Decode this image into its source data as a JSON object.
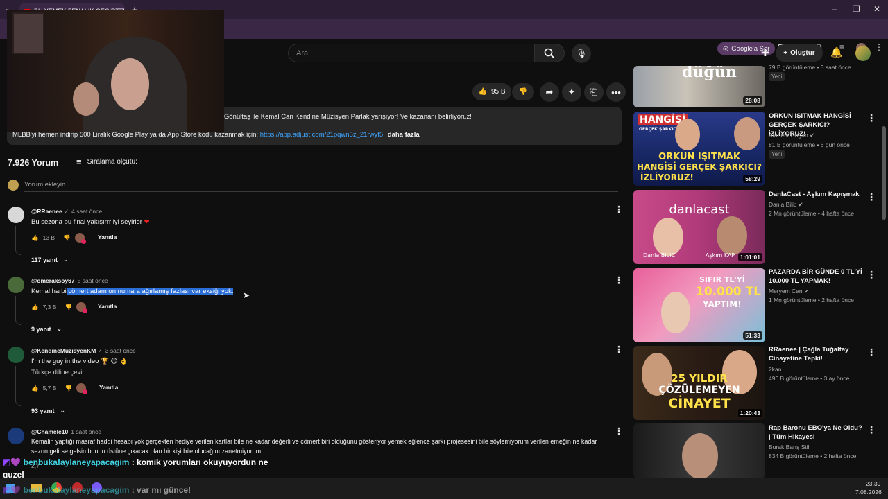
{
  "browser": {
    "tab_title": "BU YEMEK FENALIK GEÇİRTTİ!",
    "google_sor": "Google'a Sor"
  },
  "header": {
    "search_placeholder": "Ara",
    "create_label": "Oluştur"
  },
  "video": {
    "likes": "95 B"
  },
  "description": {
    "line1": "n Gönültaş ile Kemal Can Kendine Müzisyen Parlak yarışıyor! Ve kazananı belirliyoruz!",
    "line2": "MLBB'yi hemen indirip 500 Liralık Google Play ya da App Store kodu kazanmak için:",
    "link": "https://app.adjust.com/21pqwn5z_21rwyf5",
    "more": "daha fazla"
  },
  "comments_section": {
    "count": "7.926 Yorum",
    "sort_label": "Sıralama ölçütü:",
    "add_placeholder": "Yorum ekleyin..."
  },
  "comments": [
    {
      "user": "@RRaenee",
      "time": "4 saat önce",
      "text": "Bu sezona bu final yakışırrr iyi seyirler",
      "likes": "13 B",
      "reply": "Yanıtla",
      "replies": "117 yanıt",
      "avatar_color": "#d8d8d8"
    },
    {
      "user": "@omeraksoy67",
      "time": "5 saat önce",
      "text_pre": "Kemal harbi",
      "text_sel": " cömert adam on numara ağırlamış fazlası var eksiği yok.",
      "likes": "7,3 B",
      "reply": "Yanıtla",
      "replies": "9 yanıt",
      "avatar_color": "#4a6a3a"
    },
    {
      "user": "@KendineMüzisyenKM",
      "time": "3 saat önce",
      "text": "I'm the guy in the video 🏆 😌 👌",
      "translate": "Türkçe diline çevir",
      "likes": "5,7 B",
      "reply": "Yanıtla",
      "replies": "93 yanıt",
      "avatar_color": "#1f5a3a"
    },
    {
      "user": "@Chamele10",
      "time": "1 saat önce",
      "text_l1": "Kemalin yaptığı masraf haddi hesabı yok gerçekten hediye verilen kartlar bile ne kadar değerli ve cömert biri olduğunu gösteriyor yemek eğlence şarkı projesesini bile söylemiyorum  verilen emeğin ne kadar",
      "text_l2": "sezon gelirse gelsin bunun üstüne çıkacak olan bir kişi bile olucağını zanetmiyorum .",
      "likes": "2,7",
      "avatar_color": "#1a3a7a"
    }
  ],
  "sidebar": [
    {
      "title": "",
      "channel": "",
      "stats": "79 B görüntüleme • 3 saat önce",
      "badge": "Yeni",
      "duration": "28:08",
      "thumb_text": "düğün"
    },
    {
      "title": "ORKUN IŞITMAK HANGİSİ GERÇEK ŞARKICI? İZLİYORUZ!",
      "channel": "Ataberk Doğan",
      "stats": "81 B görüntüleme • 6 gün önce",
      "badge": "Yeni",
      "duration": "58:29",
      "thumb_top": "HANGİSİ",
      "thumb_sub": "GERÇEK ŞARKICI?",
      "thumb_l1": "ORKUN IŞITMAK",
      "thumb_l2": "HANGİSİ GERÇEK ŞARKICI?",
      "thumb_l3": "İZLİYORUZ!"
    },
    {
      "title": "DanlaCast - Aşkım Kapışmak",
      "channel": "Danla Bilic",
      "stats": "2 Mn görüntüleme • 4 hafta önce",
      "duration": "1:01:01",
      "thumb_text": "danlacast",
      "thumb_left": "Danla BILIC",
      "thumb_right": "Aşkım KAP"
    },
    {
      "title": "PAZARDA BİR GÜNDE 0 TL'Yİ 10.000 TL YAPMAK!",
      "channel": "Meryem Can",
      "stats": "1 Mn görüntüleme • 2 hafta önce",
      "duration": "51:33",
      "thumb_l1": "SIFIR TL'Yİ",
      "thumb_l2": "10.000 TL",
      "thumb_l3": "YAPTIM!"
    },
    {
      "title": "RRaenee | Çağla Tuğaltay Cinayetine Tepki!",
      "channel": "2kan",
      "stats": "496 B görüntüleme • 3 ay önce",
      "duration": "1:20:43",
      "thumb_l1": "25 YILDIR",
      "thumb_l2": "ÇÖZÜLEMEYEN",
      "thumb_l3": "CİNAYET"
    },
    {
      "title": "Rap Baronu EBO'ya Ne Oldu? | Tüm Hikayesi",
      "channel": "Burak Barış Stili",
      "stats": "834 B görüntüleme • 2 hafta önce"
    }
  ],
  "chat": [
    {
      "user": "benbukafaylaneyapacagim",
      "message": ": komik yorumları okuyuyordun ne",
      "cont": "guzel"
    },
    {
      "user": "benbukafaylaneyapacagim",
      "message": ": var mı günce!"
    }
  ],
  "taskbar": {
    "time": "23:39",
    "date": "7.08.2026"
  },
  "colors": {
    "accent": "#ff0000",
    "chat_name": "#3fd1e0",
    "link": "#3ea6ff",
    "selection": "#2b6ed6"
  }
}
